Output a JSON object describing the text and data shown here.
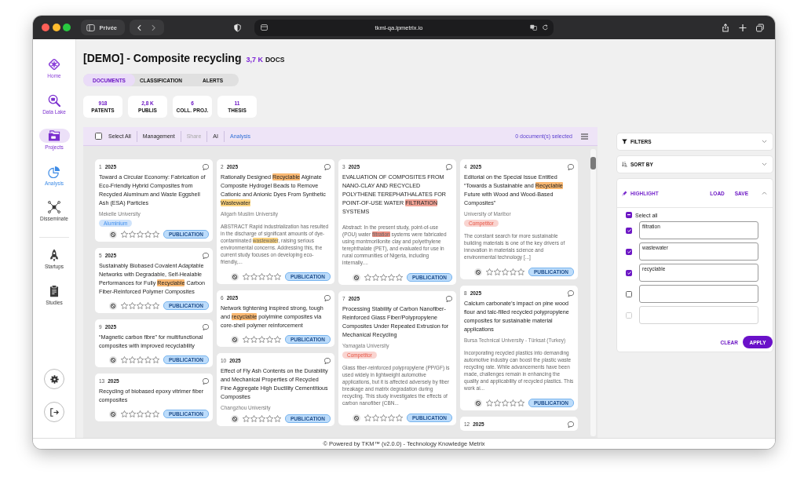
{
  "browser": {
    "private_label": "Privée",
    "url": "tkml-qa.ipmetrix.io"
  },
  "sidebar": {
    "groups": [
      {
        "items": [
          {
            "label": "Home",
            "selected": false,
            "color": "#8b3fd9"
          },
          {
            "label": "Data Lake",
            "selected": false,
            "color": "#7b2fcf"
          },
          {
            "label": "Projects",
            "selected": true,
            "color": "#7b2fcf"
          },
          {
            "label": "Analysis",
            "selected": false,
            "color": "#3d8be6"
          },
          {
            "label": "Disseminate",
            "selected": false,
            "color": "#3a3a3a"
          }
        ]
      },
      {
        "items": [
          {
            "label": "Startups",
            "selected": false,
            "color": "#3a3a3a"
          },
          {
            "label": "Studies",
            "selected": false,
            "color": "#3a3a3a"
          }
        ]
      }
    ]
  },
  "header": {
    "title": "[DEMO] - Composite recycling",
    "doc_count": "3,7 K",
    "doc_unit": "DOCS"
  },
  "tabs": [
    {
      "label": "DOCUMENTS",
      "selected": true
    },
    {
      "label": "CLASSIFICATION",
      "selected": false
    },
    {
      "label": "ALERTS",
      "selected": false
    }
  ],
  "stats": [
    {
      "value": "918",
      "label": "PATENTS"
    },
    {
      "value": "2,8 K",
      "label": "PUBLIS"
    },
    {
      "value": "6",
      "label": "COLL. PROJ."
    },
    {
      "value": "11",
      "label": "THESIS"
    }
  ],
  "toolbar": {
    "select_all": {
      "label": "Select All",
      "checked": false
    },
    "actions": [
      {
        "label": "Management",
        "kind": "button",
        "disabled": false
      },
      {
        "label": "Share",
        "kind": "button",
        "disabled": true
      },
      {
        "label": "AI",
        "kind": "button",
        "disabled": false
      },
      {
        "label": "Analysis",
        "kind": "link",
        "disabled": false
      }
    ],
    "selection_count": "0 document(s) selected"
  },
  "documents": {
    "columns": [
      {
        "cards": [
          {
            "number": "1",
            "year": "2025",
            "title": [
              {
                "text": "Toward a Circular Economy: Fabrication of Eco-Friendly Hybrid Composites from Recycled Aluminum and Waste Eggshell Ash (ESA) Particles"
              }
            ],
            "organization": "Mekelle University",
            "tags": [
              {
                "label": "Aluminium",
                "color": "#cfe3fb"
              }
            ],
            "stars": 0,
            "type": "PUBLICATION"
          },
          {
            "number": "5",
            "year": "2025",
            "title": [
              {
                "text": "Sustainably Biobased Covalent Adaptable Networks with Degradable, Self-Healable Performances for Fully "
              },
              {
                "text": "Recyclable",
                "color": "#f9b872"
              },
              {
                "text": " Carbon Fiber-Reinforced Polymer Composites"
              }
            ],
            "stars": 0,
            "type": "PUBLICATION"
          },
          {
            "number": "9",
            "year": "2025",
            "title": [
              {
                "text": "“Magnetic carbon fibre” for multifunctional composites with improved recyclability"
              }
            ],
            "stars": 0,
            "type": "PUBLICATION"
          },
          {
            "number": "13",
            "year": "2025",
            "title": [
              {
                "text": "Recycling of biobased epoxy vitrimer fiber composites"
              }
            ],
            "stars": 0,
            "type": "PUBLICATION"
          }
        ]
      },
      {
        "cards": [
          {
            "number": "2",
            "year": "2025",
            "title": [
              {
                "text": "Rationally Designed "
              },
              {
                "text": "Recyclable",
                "color": "#f9b872"
              },
              {
                "text": " Alginate Composite Hydrogel Beads to Remove Cationic and Anionic Dyes From Synthetic "
              },
              {
                "text": "Wastewater",
                "color": "#fcd47f"
              }
            ],
            "organization": "Aligarh Muslim University",
            "abstract": [
              {
                "text": "ABSTRACT Rapid industrialization has resulted in the discharge of significant amounts of dye-contaminated "
              },
              {
                "text": "wastewater",
                "color": "#fcd47f"
              },
              {
                "text": ", raising serious environmental concerns. Addressing this, the current study focuses on developing eco-friendly,..."
              }
            ],
            "stars": 0,
            "type": "PUBLICATION"
          },
          {
            "number": "6",
            "year": "2025",
            "title": [
              {
                "text": "Network tightening inspired strong, tough and "
              },
              {
                "text": "recyclable",
                "color": "#f9b872"
              },
              {
                "text": " polyimine composites via core-shell polymer reinforcement"
              }
            ],
            "stars": 0,
            "type": "PUBLICATION"
          },
          {
            "number": "10",
            "year": "2025",
            "title": [
              {
                "text": "Effect of Fly Ash Contents on the Durability and Mechanical Properties of Recycled Fine Aggregate High Ductility Cementitious Composites"
              }
            ],
            "organization": "Changzhou University",
            "stars": 0,
            "type": "PUBLICATION"
          }
        ]
      },
      {
        "cards": [
          {
            "number": "3",
            "year": "2025",
            "title": [
              {
                "text": "EVALUATION OF COMPOSITES FROM NANO-CLAY AND RECYCLED POLYTHENE TEREPHATHALATES FOR POINT-OF-USE WATER "
              },
              {
                "text": "FILTRATION",
                "color": "#f2a497"
              },
              {
                "text": " SYSTEMS"
              }
            ],
            "abstract": [
              {
                "text": "Abstract: In the present study, point-of-use (POU) water "
              },
              {
                "text": "filtration",
                "color": "#ec8e80"
              },
              {
                "text": " systems were fabricated using montmorillonite clay and polyethylene terephthalate (PET), and evaluated for use in rural communities of Nigeria, including internally...."
              }
            ],
            "stars": 0,
            "type": "PUBLICATION"
          },
          {
            "number": "7",
            "year": "2025",
            "title": [
              {
                "text": "Processing Stability of Carbon Nanofiber-Reinforced Glass Fiber/Polypropylene Composites Under Repeated Extrusion for Mechanical Recycling"
              }
            ],
            "organization": "Yamagata University",
            "tags": [
              {
                "label": "Competitor",
                "color": "#f9d4d0"
              }
            ],
            "abstract": [
              {
                "text": "Glass fiber-reinforced polypropylene (PP/GF) is used widely in lightweight automotive applications, but it is affected adversely by fiber breakage and matrix degradation during recycling. This study investigates the effects of carbon nanofiber (CBN..."
              }
            ],
            "stars": 0,
            "type": "PUBLICATION"
          }
        ]
      },
      {
        "cards": [
          {
            "number": "4",
            "year": "2025",
            "title": [
              {
                "text": "Editorial on the Special Issue Entitled “Towards a Sustainable and "
              },
              {
                "text": "Recyclable",
                "color": "#f9b872"
              },
              {
                "text": " Future with Wood and Wood-Based Composites”"
              }
            ],
            "organization": "University of Maribor",
            "tags": [
              {
                "label": "Competitor",
                "color": "#f9d4d0"
              }
            ],
            "abstract": [
              {
                "text": "The constant search for more sustainable building materials is one of the key drivers of innovation in materials science and environmental technology [...]"
              }
            ],
            "stars": 0,
            "type": "PUBLICATION"
          },
          {
            "number": "8",
            "year": "2025",
            "title": [
              {
                "text": "Calcium carbonate’s impact on pine wood flour and talc-filled recycled polypropylene composites for sustainable material applications"
              }
            ],
            "organization": "Bursa Technical University - Türksat (Turkey)",
            "abstract": [
              {
                "text": "Incorporating recycled plastics into demanding automotive industry can boost the plastic waste recycling rate. While advancements have been made, challenges remain in enhancing the quality and applicability of recycled plastics. This work ai..."
              }
            ],
            "stars": 0,
            "type": "PUBLICATION"
          },
          {
            "number": "12",
            "year": "2025"
          }
        ]
      }
    ]
  },
  "panels": [
    {
      "kind": "filters",
      "label": "FILTERS",
      "expanded": false
    },
    {
      "kind": "sort",
      "label": "SORT BY",
      "expanded": false
    },
    {
      "kind": "highlight",
      "label": "HIGHLIGHT",
      "expanded": true,
      "actions": [
        "LOAD",
        "SAVE"
      ],
      "select_all": {
        "label": "Select all",
        "indeterminate": true
      },
      "terms": [
        {
          "value": "filtration",
          "checked": true,
          "disabled": false
        },
        {
          "value": "wastewater",
          "checked": true,
          "disabled": false
        },
        {
          "value": "recyclable",
          "checked": true,
          "disabled": false
        },
        {
          "checked": false,
          "disabled": false
        },
        {
          "checked": false,
          "disabled": true
        }
      ],
      "clear_label": "CLEAR",
      "apply_label": "APPLY"
    }
  ],
  "footer": "© Powered by TKM™ (v2.0.0) - Technology Knowledge Metrix"
}
